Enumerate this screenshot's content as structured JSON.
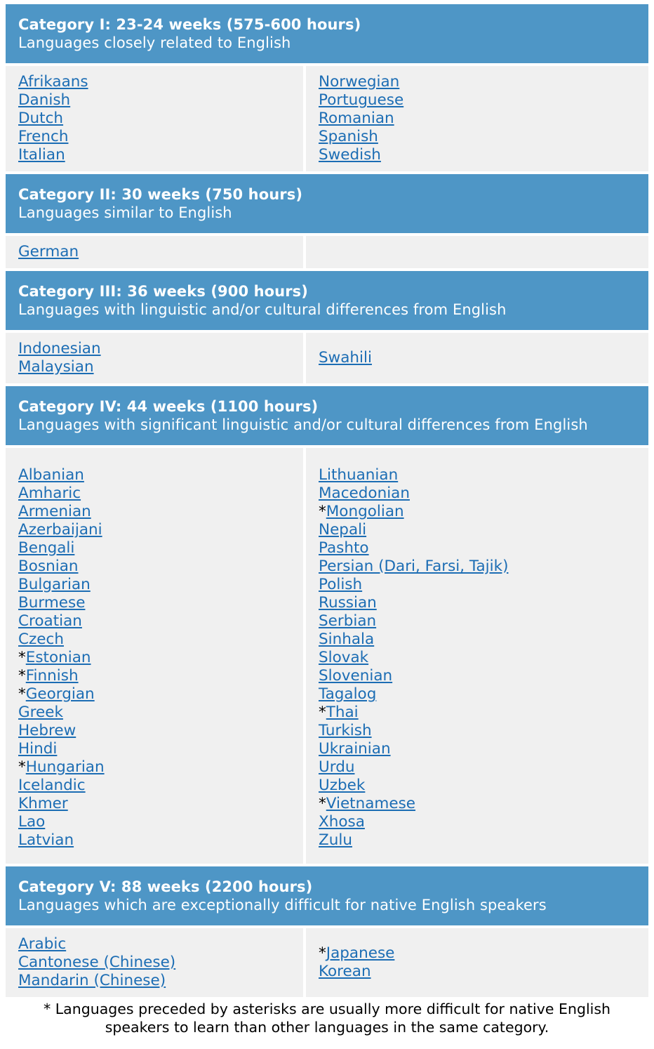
{
  "categories": [
    {
      "title": "Category I: 23-24 weeks (575-600 hours)",
      "subtitle": "Languages closely related to English",
      "left": [
        {
          "name": "Afrikaans",
          "ast": ""
        },
        {
          "name": "Danish",
          "ast": ""
        },
        {
          "name": "Dutch",
          "ast": ""
        },
        {
          "name": "French",
          "ast": ""
        },
        {
          "name": "Italian",
          "ast": ""
        }
      ],
      "right": [
        {
          "name": "Norwegian",
          "ast": ""
        },
        {
          "name": "Portuguese",
          "ast": ""
        },
        {
          "name": "Romanian",
          "ast": ""
        },
        {
          "name": "Spanish",
          "ast": ""
        },
        {
          "name": "Swedish",
          "ast": ""
        }
      ]
    },
    {
      "title": "Category II: 30 weeks (750 hours)",
      "subtitle": "Languages similar to English",
      "left": [
        {
          "name": "German",
          "ast": ""
        }
      ],
      "right": []
    },
    {
      "title": "Category III: 36 weeks (900 hours)",
      "subtitle": "Languages with linguistic and/or cultural differences from English",
      "left": [
        {
          "name": "Indonesian",
          "ast": ""
        },
        {
          "name": "Malaysian",
          "ast": ""
        }
      ],
      "right": [
        {
          "name": "Swahili",
          "ast": ""
        }
      ]
    },
    {
      "title": "Category IV: 44 weeks (1100 hours)",
      "subtitle": "Languages with significant linguistic and/or cultural differences from English",
      "left": [
        {
          "name": "Albanian",
          "ast": ""
        },
        {
          "name": "Amharic",
          "ast": ""
        },
        {
          "name": "Armenian",
          "ast": ""
        },
        {
          "name": "Azerbaijani",
          "ast": ""
        },
        {
          "name": "Bengali",
          "ast": ""
        },
        {
          "name": "Bosnian",
          "ast": ""
        },
        {
          "name": "Bulgarian",
          "ast": ""
        },
        {
          "name": "Burmese",
          "ast": ""
        },
        {
          "name": "Croatian",
          "ast": ""
        },
        {
          "name": "Czech",
          "ast": ""
        },
        {
          "name": "Estonian",
          "ast": "*"
        },
        {
          "name": "Finnish",
          "ast": "*"
        },
        {
          "name": "Georgian",
          "ast": "*"
        },
        {
          "name": "Greek",
          "ast": ""
        },
        {
          "name": "Hebrew",
          "ast": ""
        },
        {
          "name": "Hindi",
          "ast": ""
        },
        {
          "name": "Hungarian",
          "ast": "*"
        },
        {
          "name": "Icelandic",
          "ast": ""
        },
        {
          "name": "Khmer",
          "ast": ""
        },
        {
          "name": "Lao",
          "ast": ""
        },
        {
          "name": "Latvian",
          "ast": ""
        }
      ],
      "right": [
        {
          "name": "Lithuanian",
          "ast": ""
        },
        {
          "name": "Macedonian",
          "ast": ""
        },
        {
          "name": "Mongolian",
          "ast": "*"
        },
        {
          "name": "Nepali",
          "ast": ""
        },
        {
          "name": "Pashto",
          "ast": ""
        },
        {
          "name": "Persian (Dari, Farsi, Tajik)",
          "ast": ""
        },
        {
          "name": "Polish",
          "ast": ""
        },
        {
          "name": "Russian",
          "ast": ""
        },
        {
          "name": "Serbian",
          "ast": ""
        },
        {
          "name": "Sinhala",
          "ast": ""
        },
        {
          "name": "Slovak",
          "ast": ""
        },
        {
          "name": "Slovenian",
          "ast": ""
        },
        {
          "name": "Tagalog",
          "ast": ""
        },
        {
          "name": "Thai",
          "ast": "*"
        },
        {
          "name": "Turkish",
          "ast": ""
        },
        {
          "name": "Ukrainian",
          "ast": ""
        },
        {
          "name": "Urdu",
          "ast": ""
        },
        {
          "name": "Uzbek",
          "ast": ""
        },
        {
          "name": "Vietnamese",
          "ast": "*"
        },
        {
          "name": "Xhosa",
          "ast": ""
        },
        {
          "name": "Zulu",
          "ast": ""
        }
      ]
    },
    {
      "title": "Category V: 88 weeks (2200 hours)",
      "subtitle": "Languages which are exceptionally difficult for native English speakers",
      "left": [
        {
          "name": "Arabic",
          "ast": ""
        },
        {
          "name": "Cantonese (Chinese)",
          "ast": ""
        },
        {
          "name": "Mandarin (Chinese)",
          "ast": ""
        }
      ],
      "right": [
        {
          "name": "Japanese",
          "ast": "*"
        },
        {
          "name": "Korean",
          "ast": ""
        }
      ]
    }
  ],
  "footnote": "* Languages preceded by asterisks are usually more difficult for native English speakers to learn than other languages in the same category.",
  "colors": {
    "header_bg": "#4e96c6",
    "cell_bg": "#f0f0f0",
    "link": "#1c6db4"
  }
}
